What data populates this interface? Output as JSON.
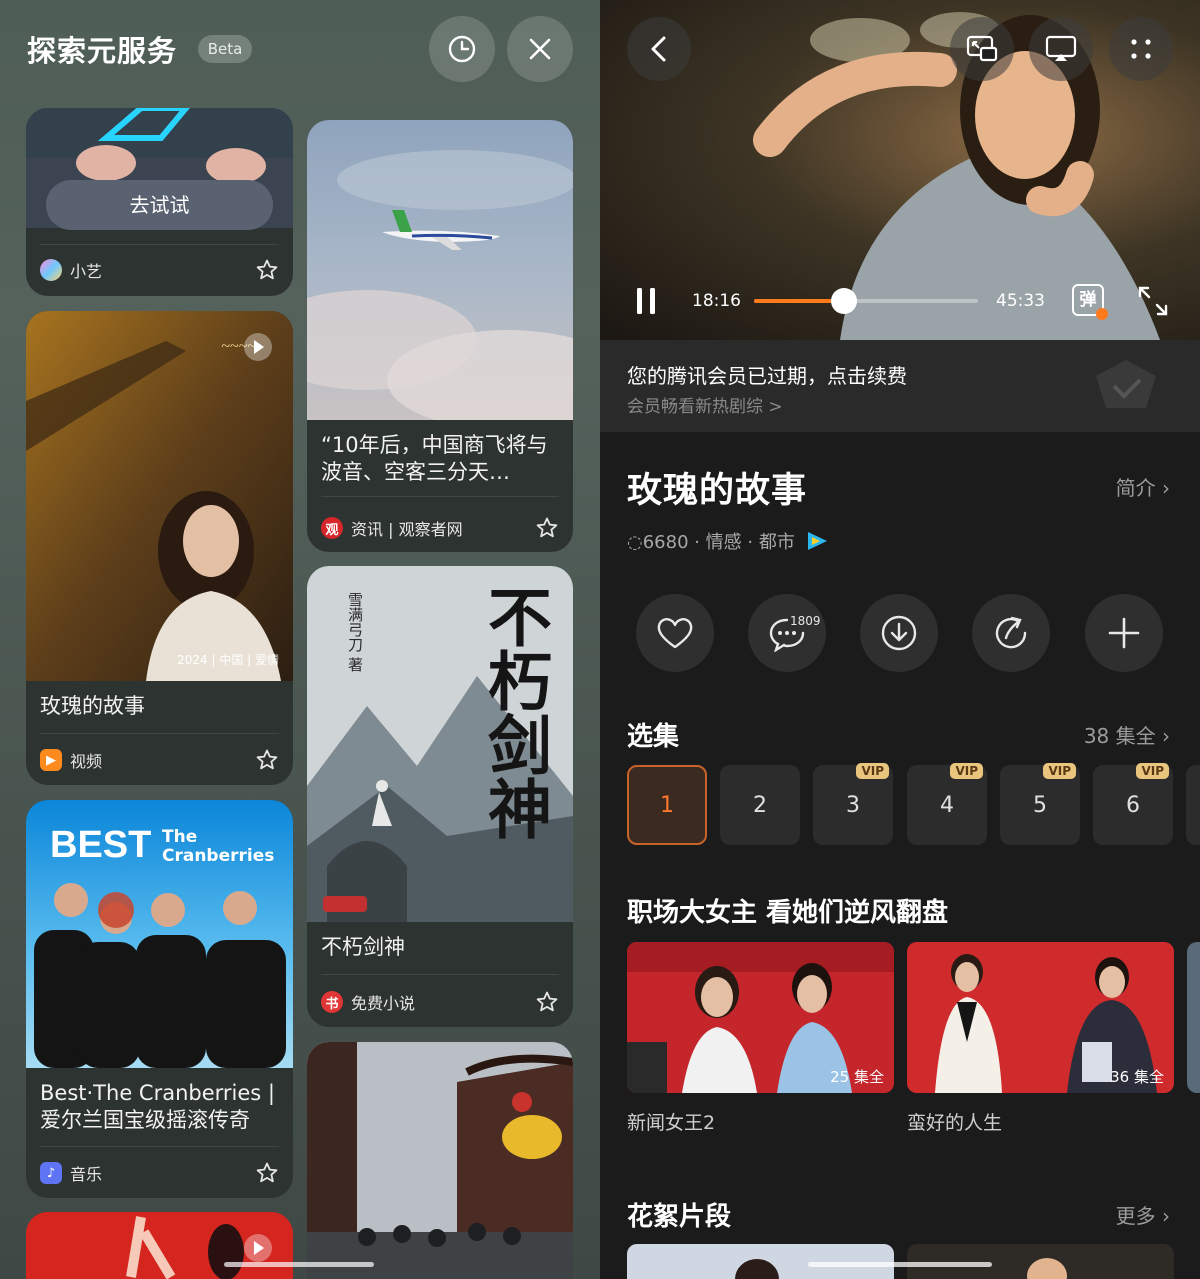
{
  "left": {
    "header": {
      "title": "探索元服务",
      "badge": "Beta"
    },
    "cards": [
      {
        "button": "去试试",
        "source": "小艺"
      },
      {
        "title": "“10年后，中国商飞将与波音、空客三分天…",
        "source": "资讯 | 观察者网"
      },
      {
        "title": "玫瑰的故事",
        "poster_caption": "2024 | 中国 | 爱情",
        "source": "视频"
      },
      {
        "title": "不朽剑神",
        "poster_title": "不朽剑神",
        "poster_author": "雪满弓刀 著",
        "source": "免费小说"
      },
      {
        "title": "Best·The Cranberries | 爱尔兰国宝级摇滚传奇",
        "poster_title": "BEST",
        "poster_band": "The Cranberries",
        "source": "音乐"
      }
    ]
  },
  "right": {
    "player": {
      "current_time": "18:16",
      "total_time": "45:33",
      "progress": 0.4,
      "danmaku_label": "弹"
    },
    "vip_notice": {
      "main": "您的腾讯会员已过期，点击续费",
      "sub": "会员畅看新热剧综 >"
    },
    "show": {
      "title": "玫瑰的故事",
      "intro_label": "简介 ›",
      "meta": "◌6680 · 情感 · 都市"
    },
    "actions": {
      "comment_count": "1809"
    },
    "episodes": {
      "section_title": "选集",
      "total_label": "38 集全 ›",
      "items": [
        {
          "num": "1",
          "vip": ""
        },
        {
          "num": "2",
          "vip": ""
        },
        {
          "num": "3",
          "vip": "VIP"
        },
        {
          "num": "4",
          "vip": "VIP"
        },
        {
          "num": "5",
          "vip": "VIP"
        },
        {
          "num": "6",
          "vip": "VIP"
        }
      ]
    },
    "recommend": {
      "section_title": "职场大女主 看她们逆风翻盘",
      "items": [
        {
          "name": "新闻女王2",
          "episodes": "25 集全"
        },
        {
          "name": "蛮好的人生",
          "episodes": "36 集全"
        }
      ]
    },
    "clips": {
      "section_title": "花絮片段",
      "more_label": "更多 ›"
    }
  },
  "colors": {
    "accent": "#ff7a1a",
    "vip_gold": "#e9c57e"
  }
}
